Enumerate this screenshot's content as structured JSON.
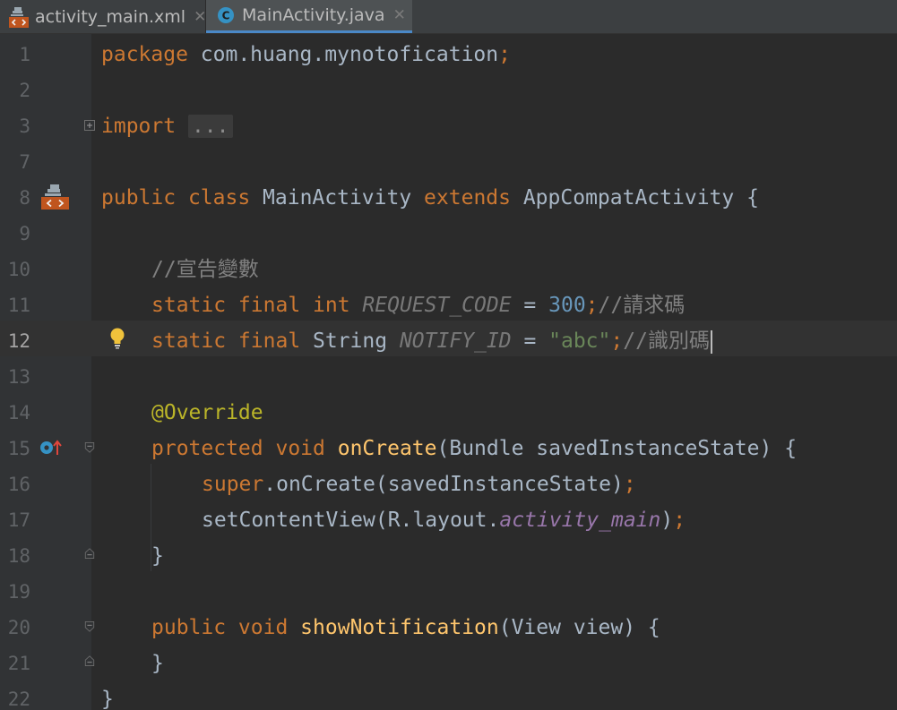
{
  "tabs": [
    {
      "label": "activity_main.xml",
      "icon": "xml-layout-file-icon",
      "active": false,
      "close": "✕"
    },
    {
      "label": "MainActivity.java",
      "icon": "java-class-c-icon",
      "active": true,
      "class_letter": "C",
      "close": "✕"
    }
  ],
  "editor": {
    "current_line": 12,
    "lines": [
      {
        "n": "1"
      },
      {
        "n": "2"
      },
      {
        "n": "3"
      },
      {
        "n": "7"
      },
      {
        "n": "8"
      },
      {
        "n": "9"
      },
      {
        "n": "10"
      },
      {
        "n": "11"
      },
      {
        "n": "12"
      },
      {
        "n": "13"
      },
      {
        "n": "14"
      },
      {
        "n": "15"
      },
      {
        "n": "16"
      },
      {
        "n": "17"
      },
      {
        "n": "18"
      },
      {
        "n": "19"
      },
      {
        "n": "20"
      },
      {
        "n": "21"
      },
      {
        "n": "22"
      }
    ],
    "code": {
      "l1_keyword": "package",
      "l1_name": " com.huang.mynotofication",
      "l1_semi": ";",
      "l3_keyword": "import",
      "l3_folded": "...",
      "l8_public": "public",
      "l8_class": " class",
      "l8_name": " MainActivity",
      "l8_extends": " extends",
      "l8_super": " AppCompatActivity {",
      "l10_comment": "//宣告變數",
      "l11_mods": "static final int",
      "l11_const": " REQUEST_CODE",
      "l11_eq": " = ",
      "l11_value": "300",
      "l11_semi": ";",
      "l11_comment": "//請求碼",
      "l12_mods": "static final",
      "l12_type": " String",
      "l12_const": " NOTIFY_ID",
      "l12_eq": " = ",
      "l12_value": "\"abc\"",
      "l12_semi": ";",
      "l12_comment": "//識別碼",
      "l14_annotation": "@Override",
      "l15_mods": "protected void",
      "l15_method": " onCreate",
      "l15_params": "(Bundle savedInstanceState) {",
      "l16_super": "super",
      "l16_call": ".onCreate(savedInstanceState)",
      "l16_semi": ";",
      "l17_call": "setContentView(R.layout.",
      "l17_field": "activity_main",
      "l17_close": ")",
      "l17_semi": ";",
      "l18_brace": "}",
      "l20_mods": "public void",
      "l20_method": " showNotification",
      "l20_params": "(View view) {",
      "l21_brace": "}",
      "l22_brace": "}"
    },
    "gutter_icons": {
      "line8": "related-layout-xml-icon",
      "line12": "intention-lightbulb-icon",
      "line15": "overrides-method-icon"
    }
  },
  "colors": {
    "background": "#2b2b2b",
    "gutter": "#313335",
    "keyword": "#cc7832",
    "string": "#6a8759",
    "number": "#6897bb",
    "comment": "#808080",
    "method": "#ffc66d",
    "annotation": "#bbb529",
    "constant": "#9876aa",
    "text": "#a9b7c6",
    "active_tab_underline": "#4a88c7"
  }
}
